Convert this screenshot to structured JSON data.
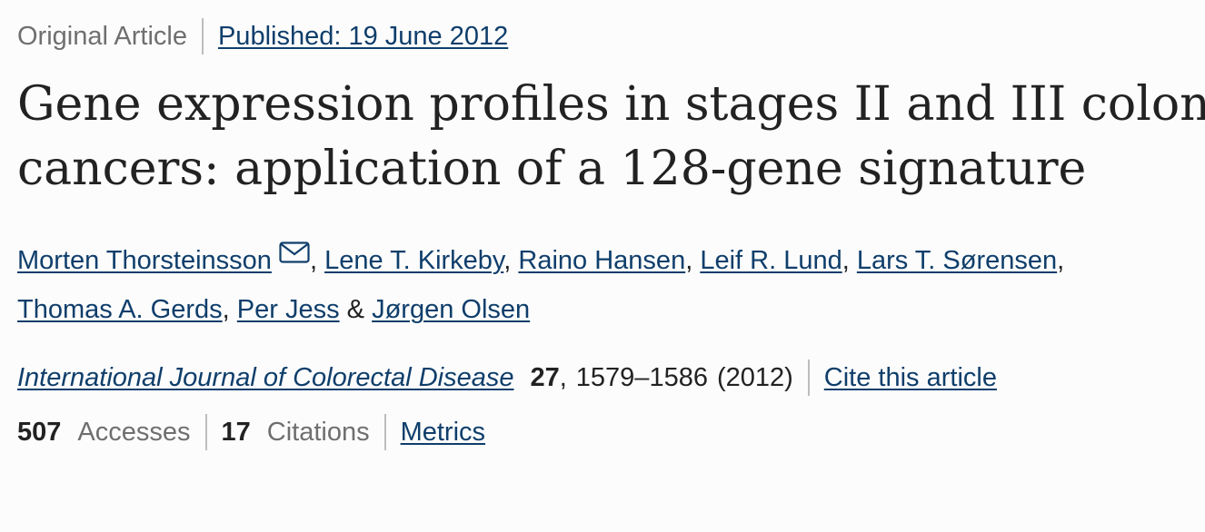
{
  "header": {
    "article_type": "Original Article",
    "published": "Published: 19 June 2012"
  },
  "title": {
    "line1": "Gene expression profiles in stages II and III colon",
    "line2": "cancers: application of a 128-gene signature"
  },
  "authors": [
    "Morten Thorsteinsson",
    "Lene T. Kirkeby",
    "Raino Hansen",
    "Leif R. Lund",
    "Lars T. Sørensen",
    "Thomas A. Gerds",
    "Per Jess",
    "Jørgen Olsen"
  ],
  "author_separators": {
    "comma": ",",
    "and": "&"
  },
  "citation": {
    "journal": "International Journal of Colorectal Disease",
    "volume": "27",
    "pages": "1579–1586",
    "year": "(2012)",
    "cite_label": "Cite this article"
  },
  "metrics": {
    "accesses_count": "507",
    "accesses_label": "Accesses",
    "citations_count": "17",
    "citations_label": "Citations",
    "metrics_link": "Metrics"
  },
  "icons": {
    "corresponding_author": "envelope-icon"
  },
  "colors": {
    "link": "#0f3e6b",
    "muted": "#6f6f6f",
    "text": "#222222",
    "separator": "#bdbdbd",
    "background": "#fcfcfc"
  }
}
